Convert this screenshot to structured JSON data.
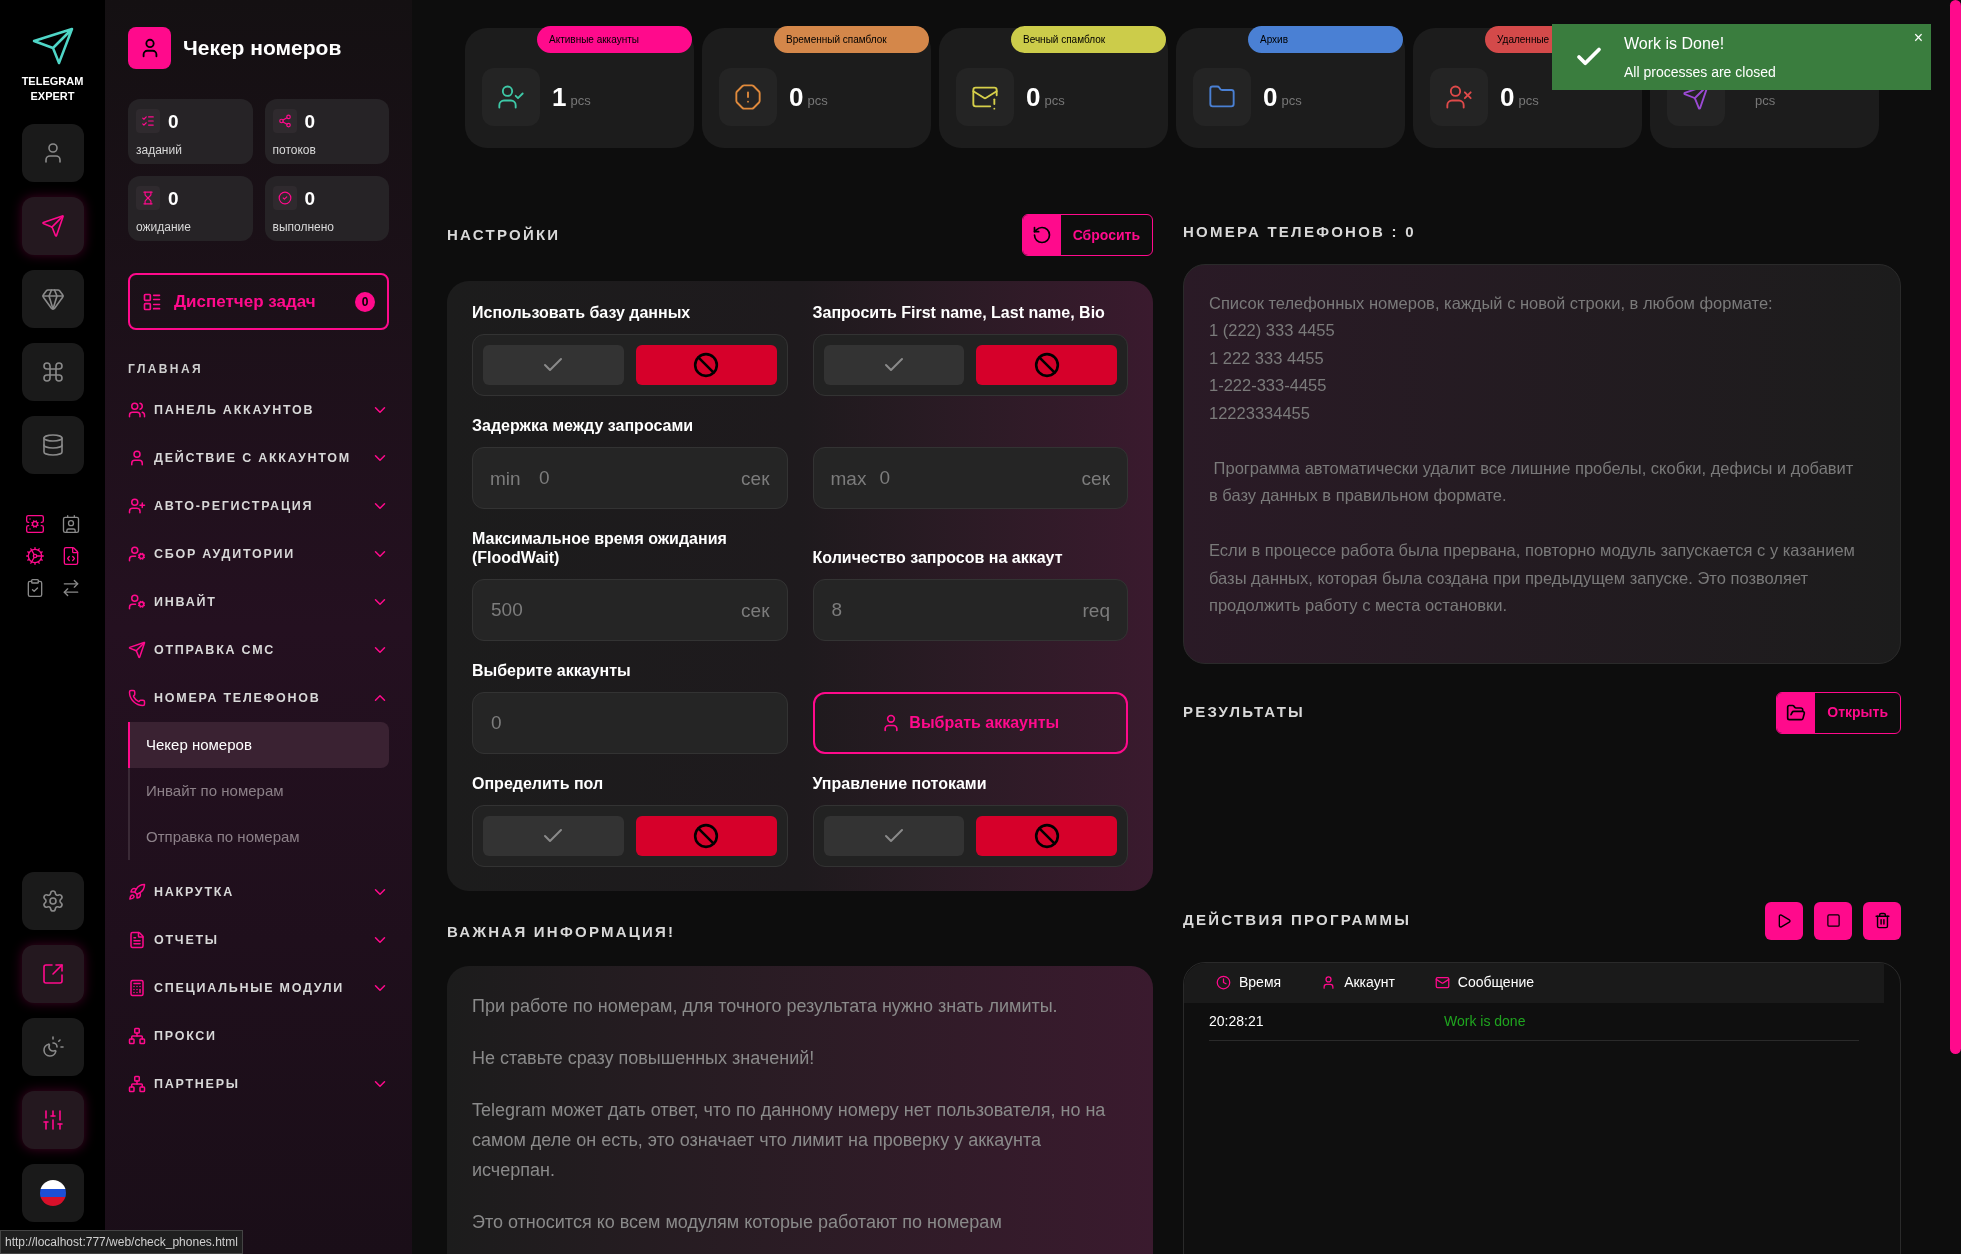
{
  "brand": {
    "line1": "TELEGRAM",
    "line2": "EXPERT"
  },
  "rail": {
    "top": [
      {
        "selected": false
      },
      {
        "selected": true
      },
      {
        "selected": false
      },
      {
        "selected": false
      },
      {
        "selected": false
      }
    ],
    "bottom": [
      {
        "selected": false
      },
      {
        "selected": true
      },
      {
        "selected": false
      },
      {
        "selected": true
      },
      {
        "selected": false
      }
    ]
  },
  "page": {
    "title": "Чекер номеров"
  },
  "counters": [
    {
      "value": "0",
      "label": "заданий"
    },
    {
      "value": "0",
      "label": "потоков"
    },
    {
      "value": "0",
      "label": "ожидание"
    },
    {
      "value": "0",
      "label": "выполнено"
    }
  ],
  "dispatcher": {
    "label": "Диспетчер задач",
    "count": "0"
  },
  "nav_heading": "ГЛАВНАЯ",
  "nav": [
    {
      "kind": "group",
      "label": "ПАНЕЛЬ АККАУНТОВ",
      "expanded": false
    },
    {
      "kind": "group",
      "label": "ДЕЙСТВИЕ С АККАУНТОМ",
      "expanded": false
    },
    {
      "kind": "group",
      "label": "АВТО-РЕГИСТРАЦИЯ",
      "expanded": false
    },
    {
      "kind": "group",
      "label": "СБОР АУДИТОРИИ",
      "expanded": false
    },
    {
      "kind": "group",
      "label": "ИНВАЙТ",
      "expanded": false
    },
    {
      "kind": "group",
      "label": "ОТПРАВКА СМС",
      "expanded": false
    },
    {
      "kind": "group",
      "label": "НОМЕРА ТЕЛЕФОНОВ",
      "expanded": true,
      "children": [
        {
          "label": "Чекер номеров",
          "selected": true
        },
        {
          "label": "Инвайт по номерам",
          "selected": false
        },
        {
          "label": "Отправка по номерам",
          "selected": false
        }
      ]
    },
    {
      "kind": "group",
      "label": "НАКРУТКА",
      "expanded": false
    },
    {
      "kind": "group",
      "label": "ОТЧЕТЫ",
      "expanded": false
    },
    {
      "kind": "group",
      "label": "СПЕЦИАЛЬНЫЕ МОДУЛИ",
      "expanded": false
    },
    {
      "kind": "link",
      "label": "ПРОКСИ"
    },
    {
      "kind": "group",
      "label": "ПАРТНЕРЫ",
      "expanded": false
    }
  ],
  "stats": [
    {
      "badge": "Активные аккаунты",
      "color": "#ff0a8c",
      "value": "1",
      "unit": "pcs"
    },
    {
      "badge": "Временный спамблок",
      "color": "#d4874a",
      "value": "0",
      "unit": "pcs"
    },
    {
      "badge": "Вечный спамблок",
      "color": "#cccc4a",
      "value": "0",
      "unit": "pcs"
    },
    {
      "badge": "Архив",
      "color": "#4a80d4",
      "value": "0",
      "unit": "pcs"
    },
    {
      "badge": "Удаленные",
      "color": "#d44a4a",
      "value": "0",
      "unit": "pcs"
    },
    {
      "unit": "pcs"
    }
  ],
  "toast": {
    "title": "Work is Done!",
    "message": "All processes are closed",
    "close": "×"
  },
  "settings": {
    "heading": "НАСТРОЙКИ",
    "reset": "Сбросить",
    "rows": [
      [
        {
          "kind": "toggle",
          "label": "Использовать базу данных",
          "on": false
        },
        {
          "kind": "toggle",
          "label": "Запросить First name, Last name, Bio",
          "on": false
        }
      ],
      [
        {
          "kind": "range",
          "label": "Задержка между запросами",
          "prefix": "min",
          "placeholder": "0",
          "unit": "сек"
        },
        {
          "kind": "range",
          "prefix": "max",
          "placeholder": "0",
          "unit": "сек"
        }
      ],
      [
        {
          "kind": "number",
          "label": "Максимальное время ожидания (FloodWait)",
          "placeholder": "500",
          "unit": "сек"
        },
        {
          "kind": "number",
          "label": "Количество запросов на аккаут",
          "placeholder": "8",
          "unit": "req"
        }
      ],
      [
        {
          "kind": "number",
          "label": "Выберите аккаунты",
          "placeholder": "0"
        },
        {
          "kind": "button",
          "label": "Выбрать аккаунты"
        }
      ],
      [
        {
          "kind": "toggle",
          "label": "Определить пол",
          "on": false
        },
        {
          "kind": "toggle",
          "label": "Управление потоками",
          "on": false
        }
      ]
    ]
  },
  "info": {
    "heading": "ВАЖНАЯ ИНФОРМАЦИЯ!",
    "paragraphs": [
      "При работе по номерам, для точного результата нужно знать лимиты.",
      "Не ставьте сразу повышенных значений!",
      "Telegram может дать ответ, что по данному номеру нет пользователя, но на самом деле он есть, это означает что лимит на проверку у аккаунта исчерпан.",
      "Это относится ко всем модулям которые работают по номерам"
    ]
  },
  "phones": {
    "heading": "НОМЕРА ТЕЛЕФОНОВ : 0",
    "placeholder": "Список телефонных номеров, каждый с новой строки, в любом формате:\n1 (222) 333 4455\n1 222 333 4455\n1-222-333-4455\n12223334455\n\n Программа автоматически удалит все лишние пробелы, скобки, дефисы и добавит в базу данных в правильном формате.\n\nЕсли в процессе работа была прервана, повторно модуль запускается с у казанием базы данных, которая была создана при предыдущем запуске. Это позволяет продолжить работу с места остановки."
  },
  "results": {
    "heading": "РЕЗУЛЬТАТЫ",
    "open": "Открыть"
  },
  "log": {
    "heading": "ДЕЙСТВИЯ ПРОГРАММЫ",
    "columns": [
      "Время",
      "Аккаунт",
      "Сообщение"
    ],
    "rows": [
      {
        "time": "20:28:21",
        "message": "Work is done"
      }
    ]
  },
  "status_url": "http://localhost:777/web/check_phones.html"
}
